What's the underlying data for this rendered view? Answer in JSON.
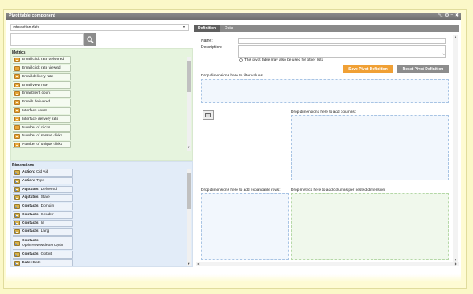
{
  "window": {
    "title": "Pivot table component",
    "tools": [
      "wrench-icon",
      "gear-icon",
      "minimize-icon",
      "close-icon"
    ]
  },
  "datasource": {
    "selected": "Interaction data"
  },
  "metrics": {
    "heading": "Metrics",
    "items": [
      "Email click rate delivered",
      "Email click rate viewed",
      "Email delivery rate",
      "Email view rate",
      "Emailclient count",
      "Emails delivered",
      "Interface count",
      "Interface delivery rate",
      "Number of clicks",
      "Number of sensor clicks",
      "Number of unique clicks"
    ]
  },
  "dimensions": {
    "heading": "Dimensions",
    "items": [
      {
        "prefix": "Action:",
        "name": "Cid Aid"
      },
      {
        "prefix": "Action:",
        "name": "Type"
      },
      {
        "prefix": "Aqstatus:",
        "name": "Delivered"
      },
      {
        "prefix": "Aqstatus:",
        "name": "State"
      },
      {
        "prefix": "Contacts:",
        "name": "Domain"
      },
      {
        "prefix": "Contacts:",
        "name": "Gender"
      },
      {
        "prefix": "Contacts:",
        "name": "Id"
      },
      {
        "prefix": "Contacts:",
        "name": "Lang"
      },
      {
        "prefix": "Contacts:",
        "name": "Optin##Newsletter Optin"
      },
      {
        "prefix": "Contacts:",
        "name": "Optout"
      },
      {
        "prefix": "Date:",
        "name": "Date"
      }
    ]
  },
  "tabs": [
    {
      "label": "Definition",
      "active": true
    },
    {
      "label": "Data",
      "active": false
    }
  ],
  "form": {
    "name_label": "Name:",
    "name_value": "",
    "description_label": "Description:",
    "description_value": "",
    "shared_checkbox_label": "This pivot table may also be used for other lists",
    "shared_checked": false
  },
  "buttons": {
    "save": "Save Pivot Definition",
    "reset": "Reset Pivot Definition"
  },
  "dropzones": {
    "filter": "Drop dimensions here to filter values:",
    "columns": "Drop dimensions here to add columns:",
    "rows": "Drop dimensions here to add expandable rows:",
    "metrics": "Drop metrics here to add columns per nested dimension:"
  },
  "colors": {
    "accent": "#f0a035",
    "titlebar": "#7a7a7a",
    "metrics_bg": "#e6f4de",
    "dims_bg": "#e2ecf8"
  }
}
